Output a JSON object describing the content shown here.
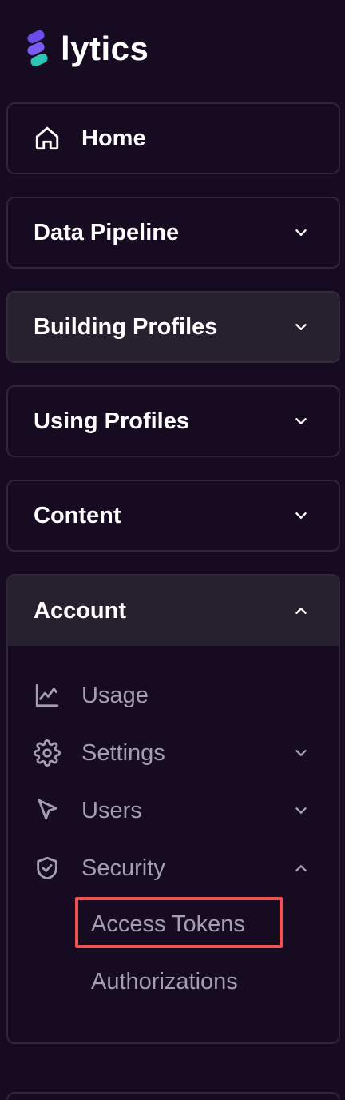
{
  "brand": {
    "name": "lytics"
  },
  "nav": {
    "home": "Home",
    "data_pipeline": "Data Pipeline",
    "building_profiles": "Building Profiles",
    "using_profiles": "Using Profiles",
    "content": "Content",
    "account": "Account"
  },
  "account": {
    "items": [
      {
        "label": "Usage",
        "icon": "chart-line-icon",
        "expandable": false
      },
      {
        "label": "Settings",
        "icon": "gear-icon",
        "expandable": true,
        "expanded": false
      },
      {
        "label": "Users",
        "icon": "cursor-pointer-icon",
        "expandable": true,
        "expanded": false
      },
      {
        "label": "Security",
        "icon": "shield-check-icon",
        "expandable": true,
        "expanded": true
      }
    ],
    "security_children": [
      "Access Tokens",
      "Authorizations"
    ],
    "selected": "Access Tokens"
  },
  "colors": {
    "background": "#170b22",
    "card_border": "#2e2538",
    "active_card": "#27202f",
    "muted_text": "#a49eaf",
    "highlight": "#f0534f"
  }
}
